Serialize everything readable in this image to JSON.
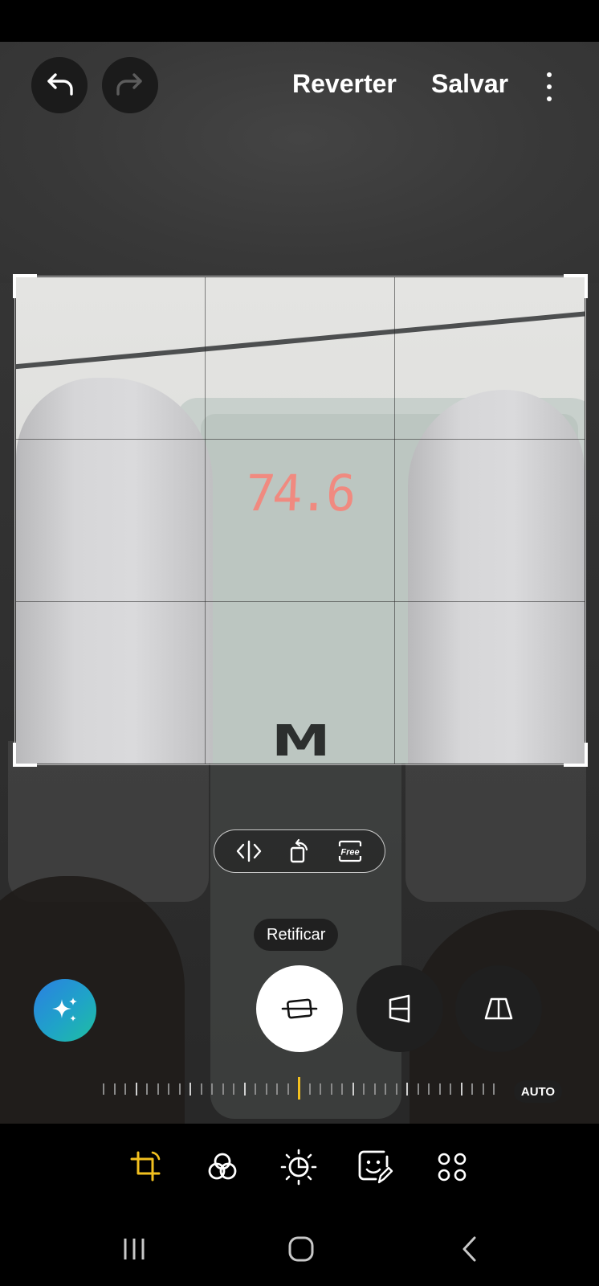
{
  "header": {
    "revert_label": "Reverter",
    "save_label": "Salvar"
  },
  "photo": {
    "scale_reading": "74.6",
    "scale_logo": "M"
  },
  "transform_tools": {
    "aspect_label": "Free"
  },
  "tooltip": {
    "label": "Retificar"
  },
  "dial": {
    "auto_label": "AUTO"
  },
  "colors": {
    "accent": "#f2c01f",
    "ai_gradient_start": "#2b7fe2",
    "ai_gradient_end": "#1fbfa0",
    "display_digits": "#f08a80"
  },
  "toolbar": {
    "items": [
      "crop-rotate-icon",
      "filters-icon",
      "brightness-icon",
      "sticker-icon",
      "more-tools-icon"
    ],
    "active": "crop-rotate-icon"
  }
}
